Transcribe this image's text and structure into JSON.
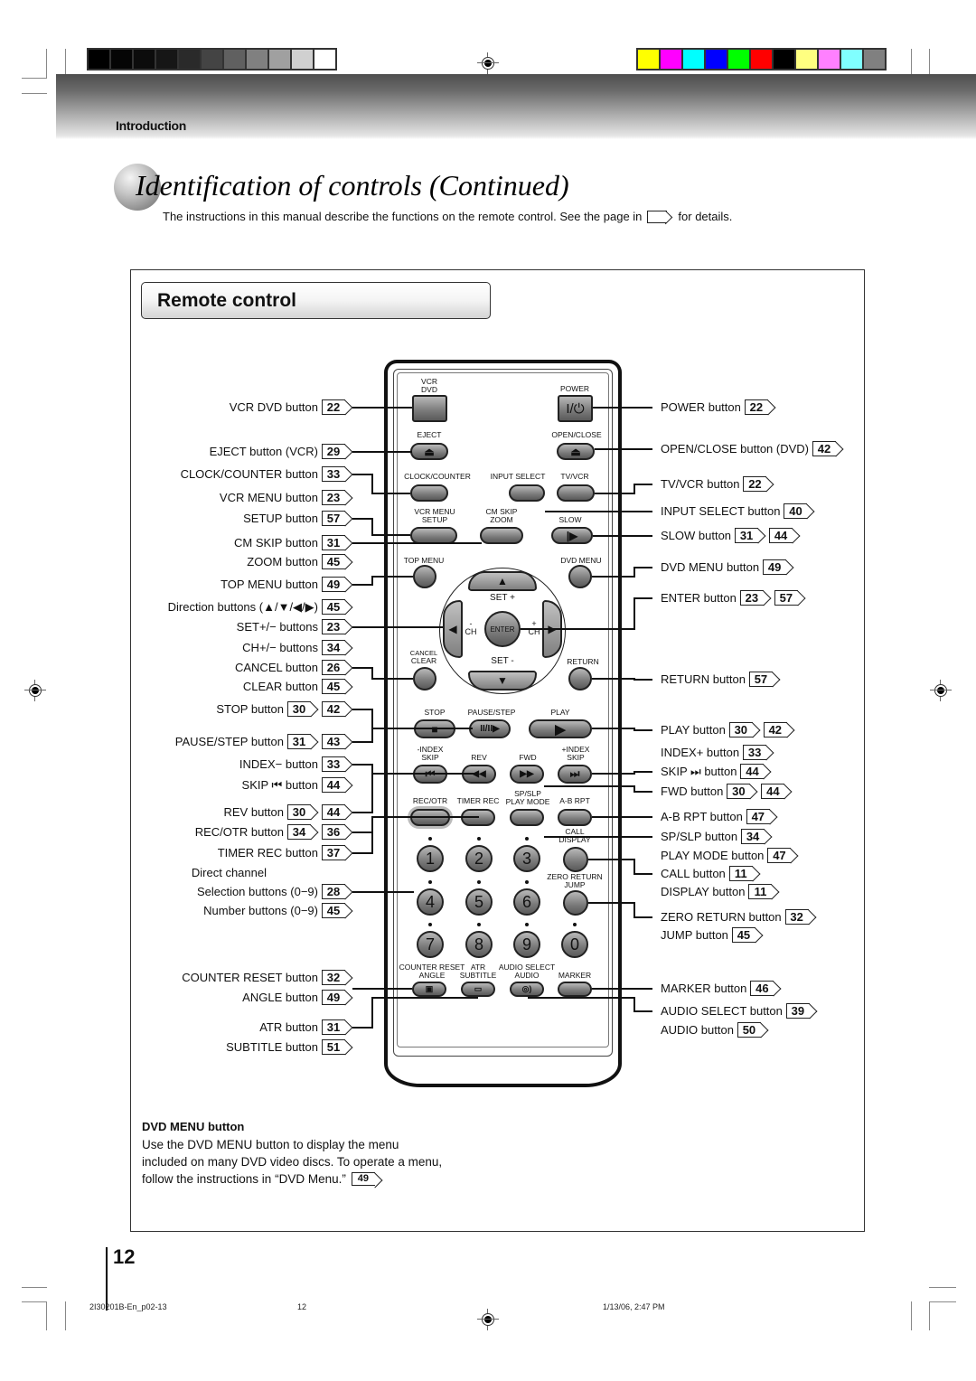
{
  "print_marks": {
    "gray_swatches": [
      "#000000",
      "#050505",
      "#0c0c0c",
      "#161616",
      "#2a2a2a",
      "#444444",
      "#606060",
      "#808080",
      "#a0a0a0",
      "#d0d0d0",
      "#ffffff"
    ],
    "color_swatches": [
      "#ffff00",
      "#ff00ff",
      "#00ffff",
      "#0000ff",
      "#00ff00",
      "#ff0000",
      "#000000",
      "#ffff80",
      "#ff80ff",
      "#80ffff",
      "#808080"
    ]
  },
  "header": {
    "section": "Introduction"
  },
  "page_title": "Identification of controls (Continued)",
  "intro": {
    "before": "The instructions in this manual describe the functions on the remote control. See the page in",
    "after": "for details."
  },
  "panel_title": "Remote control",
  "left_labels": [
    {
      "text": "VCR DVD button",
      "refs": [
        "22"
      ]
    },
    {
      "text": "EJECT button (VCR)",
      "refs": [
        "29"
      ]
    },
    {
      "text": "CLOCK/COUNTER button",
      "refs": [
        "33"
      ]
    },
    {
      "text": "VCR MENU button",
      "refs": [
        "23"
      ]
    },
    {
      "text": "SETUP button",
      "refs": [
        "57"
      ]
    },
    {
      "text": "CM SKIP button",
      "refs": [
        "31"
      ]
    },
    {
      "text": "ZOOM button",
      "refs": [
        "45"
      ]
    },
    {
      "text": "TOP MENU button",
      "refs": [
        "49"
      ]
    },
    {
      "text": "Direction buttons (▲/▼/◀/▶)",
      "refs": [
        "45"
      ]
    },
    {
      "text": "SET+/− buttons",
      "refs": [
        "23"
      ]
    },
    {
      "text": "CH+/− buttons",
      "refs": [
        "34"
      ]
    },
    {
      "text": "CANCEL button",
      "refs": [
        "26"
      ]
    },
    {
      "text": "CLEAR button",
      "refs": [
        "45"
      ]
    },
    {
      "text": "STOP button",
      "refs": [
        "30",
        "42"
      ]
    },
    {
      "text": "PAUSE/STEP button",
      "refs": [
        "31",
        "43"
      ]
    },
    {
      "text": "INDEX− button",
      "refs": [
        "33"
      ]
    },
    {
      "text": "SKIP ⏮ button",
      "refs": [
        "44"
      ]
    },
    {
      "text": "REV button",
      "refs": [
        "30",
        "44"
      ]
    },
    {
      "text": "REC/OTR button",
      "refs": [
        "34",
        "36"
      ]
    },
    {
      "text": "TIMER REC button",
      "refs": [
        "37"
      ]
    },
    {
      "text": "Direct channel",
      "refs": []
    },
    {
      "text": "Selection buttons (0−9)",
      "refs": [
        "28"
      ]
    },
    {
      "text": "Number buttons (0−9)",
      "refs": [
        "45"
      ]
    },
    {
      "text": "COUNTER RESET button",
      "refs": [
        "32"
      ]
    },
    {
      "text": "ANGLE button",
      "refs": [
        "49"
      ]
    },
    {
      "text": "ATR button",
      "refs": [
        "31"
      ]
    },
    {
      "text": "SUBTITLE button",
      "refs": [
        "51"
      ]
    }
  ],
  "right_labels": [
    {
      "text": "POWER button",
      "refs": [
        "22"
      ]
    },
    {
      "text": "OPEN/CLOSE button (DVD)",
      "refs": [
        "42"
      ]
    },
    {
      "text": "TV/VCR button",
      "refs": [
        "22"
      ]
    },
    {
      "text": "INPUT SELECT button",
      "refs": [
        "40"
      ]
    },
    {
      "text": "SLOW button",
      "refs": [
        "31",
        "44"
      ]
    },
    {
      "text": "DVD MENU button",
      "refs": [
        "49"
      ]
    },
    {
      "text": "ENTER button",
      "refs": [
        "23",
        "57"
      ]
    },
    {
      "text": "RETURN button",
      "refs": [
        "57"
      ]
    },
    {
      "text": "PLAY button",
      "refs": [
        "30",
        "42"
      ]
    },
    {
      "text": "INDEX+ button",
      "refs": [
        "33"
      ]
    },
    {
      "text": "SKIP ⏭ button",
      "refs": [
        "44"
      ]
    },
    {
      "text": "FWD button",
      "refs": [
        "30",
        "44"
      ]
    },
    {
      "text": "A-B RPT button",
      "refs": [
        "47"
      ]
    },
    {
      "text": "SP/SLP button",
      "refs": [
        "34"
      ]
    },
    {
      "text": "PLAY MODE button",
      "refs": [
        "47"
      ]
    },
    {
      "text": "CALL button",
      "refs": [
        "11"
      ]
    },
    {
      "text": "DISPLAY button",
      "refs": [
        "11"
      ]
    },
    {
      "text": "ZERO RETURN button",
      "refs": [
        "32"
      ]
    },
    {
      "text": "JUMP button",
      "refs": [
        "45"
      ]
    },
    {
      "text": "MARKER button",
      "refs": [
        "46"
      ]
    },
    {
      "text": "AUDIO SELECT button",
      "refs": [
        "39"
      ]
    },
    {
      "text": "AUDIO button",
      "refs": [
        "50"
      ]
    }
  ],
  "remote": {
    "vcr_dvd": "VCR\nDVD",
    "power": "POWER",
    "power_glyph": "I/⏻",
    "eject": "EJECT",
    "open_close": "OPEN/CLOSE",
    "eject_glyph": "⏏",
    "clock_counter": "CLOCK/COUNTER",
    "input_select": "INPUT SELECT",
    "tv_vcr": "TV/VCR",
    "vcr_menu": "VCR MENU",
    "setup": "SETUP",
    "cm_skip": "CM SKIP",
    "zoom": "ZOOM",
    "slow": "SLOW",
    "slow_glyph": "|▶",
    "top_menu": "TOP MENU",
    "dvd_menu": "DVD MENU",
    "set_plus": "SET +",
    "set_minus": "SET -",
    "ch_minus": "-\nCH",
    "ch_plus": "+\nCH",
    "enter": "ENTER",
    "cancel": "CANCEL",
    "clear": "CLEAR",
    "return": "RETURN",
    "stop": "STOP",
    "pause_step": "PAUSE/STEP",
    "play": "PLAY",
    "stop_glyph": "■",
    "pause_glyph": "II/II▶",
    "play_glyph": "▶",
    "index_minus": "-INDEX",
    "skip_l": "SKIP",
    "rev": "REV",
    "fwd": "FWD",
    "index_plus": "+INDEX",
    "skip_r": "SKIP",
    "skip_back_glyph": "⏮",
    "rev_glyph": "◀◀",
    "fwd_glyph": "▶▶",
    "skip_fwd_glyph": "⏭",
    "rec_otr": "REC/OTR",
    "timer_rec": "TIMER REC",
    "sp_slp": "SP/SLP",
    "play_mode": "PLAY MODE",
    "ab_rpt": "A-B RPT",
    "call": "CALL",
    "display": "DISPLAY",
    "zero_return": "ZERO RETURN",
    "jump": "JUMP",
    "numbers": [
      "1",
      "2",
      "3",
      "4",
      "5",
      "6",
      "7",
      "8",
      "9",
      "0"
    ],
    "counter_reset": "COUNTER RESET",
    "angle": "ANGLE",
    "atr": "ATR",
    "subtitle": "SUBTITLE",
    "audio_select": "AUDIO SELECT",
    "audio": "AUDIO",
    "marker": "MARKER",
    "angle_glyph": "🎥",
    "subtitle_glyph": "▭",
    "audio_glyph": "◎)"
  },
  "description": {
    "heading": "DVD MENU button",
    "line1": "Use the DVD MENU button to display the menu",
    "line2": "included on many DVD video discs. To operate a menu,",
    "line3": "follow the instructions in “DVD Menu.”",
    "ref": "49"
  },
  "page_number": "12",
  "footer": {
    "file": "2I30201B-En_p02-13",
    "page": "12",
    "timestamp": "1/13/06, 2:47 PM"
  }
}
